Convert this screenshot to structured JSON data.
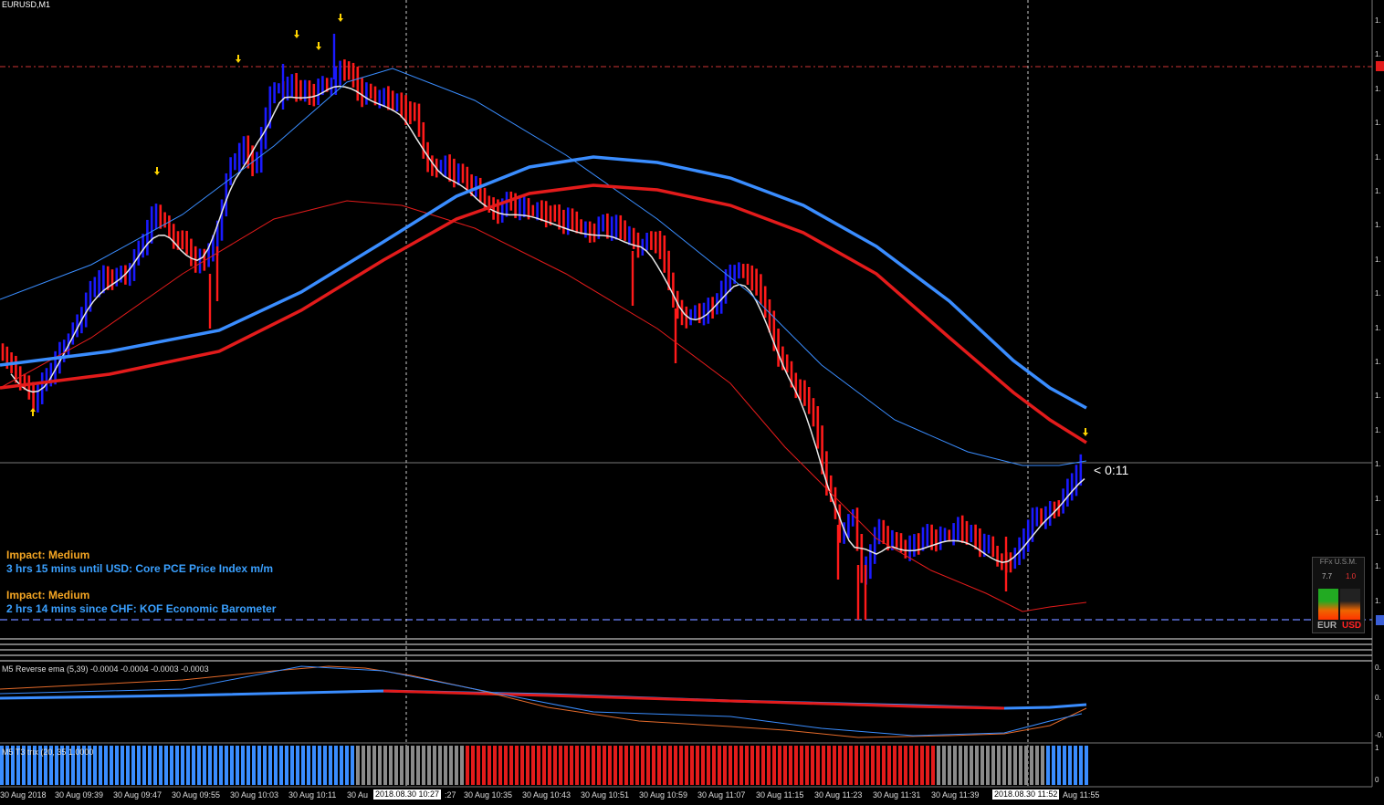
{
  "window": {
    "symbol": "EURUSD,M1"
  },
  "timer": "< 0:11",
  "news": [
    {
      "impact": "Impact: Medium",
      "event": "3 hrs 15 mins until USD: Core PCE Price Index m/m"
    },
    {
      "impact": "Impact: Medium",
      "event": "2 hrs 14 mins since CHF: KOF Economic Barometer"
    }
  ],
  "indicators": {
    "reverse_ema": "M5 Reverse ema (5,39) -0.0004 -0.0004 -0.0003 -0.0003",
    "t3_trix": "M5 T3 trix (20, 35 1.0000"
  },
  "time_axis": [
    "30 Aug 2018",
    "30 Aug 09:39",
    "30 Aug 09:47",
    "30 Aug 09:55",
    "30 Aug 10:03",
    "30 Aug 10:11",
    "30 Au",
    ":27",
    "30 Aug 10:35",
    "30 Aug 10:43",
    "30 Aug 10:51",
    "30 Aug 10:59",
    "30 Aug 11:07",
    "30 Aug 11:15",
    "30 Aug 11:23",
    "30 Aug 11:31",
    "30 Aug 11:39",
    "Aug 11:55"
  ],
  "time_tags": [
    "2018.08.30 10:27",
    "2018.08.30 11:52"
  ],
  "price_ticks": [
    "1.",
    "1.",
    "1.",
    "1.",
    "1.",
    "1.",
    "1.",
    "1.",
    "1.",
    "1.",
    "1.",
    "1.",
    "1.",
    "1.",
    "1.",
    "1.",
    "1.",
    "1."
  ],
  "sub_ticks": [
    "0.",
    "0.",
    "-0.",
    "1",
    "0"
  ],
  "ffx_panel": {
    "title": "FFx U.S.M.",
    "v1": "7.7",
    "v2": "1.0",
    "base": "EUR",
    "quote": "USD"
  },
  "colors": {
    "bull": "#1a1aff",
    "bear": "#ff1a1a",
    "ema_fast": "#e8e8e8",
    "blue_line": "#3a8dff",
    "red_line": "#e31b1b",
    "gray_hist": "#8a8a8a",
    "arrow": "#ffd400"
  }
}
